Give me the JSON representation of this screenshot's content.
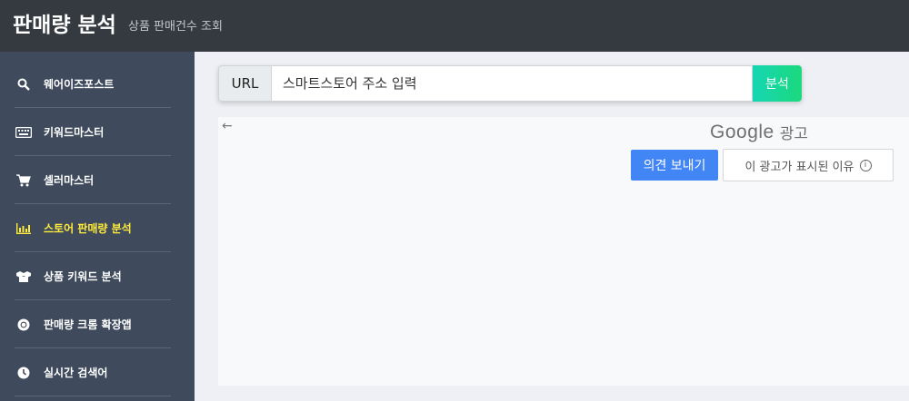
{
  "header": {
    "title": "판매량 분석",
    "subtitle": "상품 판매건수 조회"
  },
  "sidebar": {
    "items": [
      {
        "label": "웨어이즈포스트",
        "icon": "search-icon"
      },
      {
        "label": "키워드마스터",
        "icon": "keyboard-icon"
      },
      {
        "label": "셀러마스터",
        "icon": "cart-icon"
      },
      {
        "label": "스토어 판매량 분석",
        "icon": "bar-chart-icon",
        "active": true
      },
      {
        "label": "상품 키워드 분석",
        "icon": "boxes-icon"
      },
      {
        "label": "판매량 크롬 확장앱",
        "icon": "chrome-icon"
      },
      {
        "label": "실시간 검색어",
        "icon": "clock-icon"
      }
    ],
    "active_color": "#ffeb3b"
  },
  "search": {
    "addon_label": "URL",
    "placeholder": "스마트스토어 주소 입력",
    "value": "",
    "submit_label": "분석"
  },
  "ad": {
    "brand": "Google",
    "brand_suffix": "광고",
    "feedback_label": "의견 보내기",
    "why_label": "이 광고가 표시된 이유",
    "back_icon": "arrow-left-icon",
    "info_icon": "info-icon"
  }
}
